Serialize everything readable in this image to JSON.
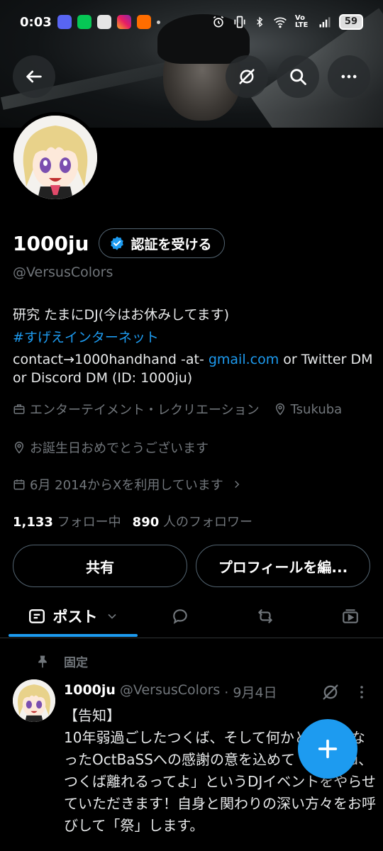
{
  "status_bar": {
    "time": "0:03",
    "battery": "59",
    "network": "Vo LTE"
  },
  "header": {
    "back_icon": "arrow-left-icon",
    "grok_icon": "slashed-circle-icon",
    "search_icon": "search-icon",
    "more_icon": "more-horizontal-icon"
  },
  "profile": {
    "display_name": "1000ju",
    "verify_label": "認証を受ける",
    "handle": "@VersusColors",
    "bio_line1": "研究 たまにDJ(今はお休みしてます)",
    "bio_hashtag": "#すげえインターネット",
    "bio_contact_prefix": "contact→1000handhand -at- ",
    "bio_contact_link": "gmail.com",
    "bio_contact_suffix": " or Twitter DM or Discord DM (ID: 1000ju)",
    "category": "エンターテイメント・レクリエーション",
    "location": "Tsukuba",
    "birthday": "お誕生日おめでとうございます",
    "joined": "6月 2014からXを利用しています",
    "following_count": "1,133",
    "following_label": "フォロー中",
    "followers_count": "890",
    "followers_label": "人のフォロワー",
    "share_label": "共有",
    "edit_label": "プロフィールを編..."
  },
  "tabs": {
    "posts_label": "ポスト"
  },
  "pinned_post": {
    "pinned_label": "固定",
    "author_name": "1000ju",
    "author_handle": "@VersusColors",
    "date": "· 9月4日",
    "text": "【告知】\n10年弱過ごしたつくば、そして何かと世話になったOctBaSSへの感謝の意を込めて「1000ju、つくば離れるってよ」というDJイベントをやらせていただきます！自身と関わりの深い方々をお呼びして「祭」します。"
  },
  "colors": {
    "accent": "#1d9bf0",
    "muted": "#71767b",
    "border": "#536471",
    "background": "#000000"
  }
}
